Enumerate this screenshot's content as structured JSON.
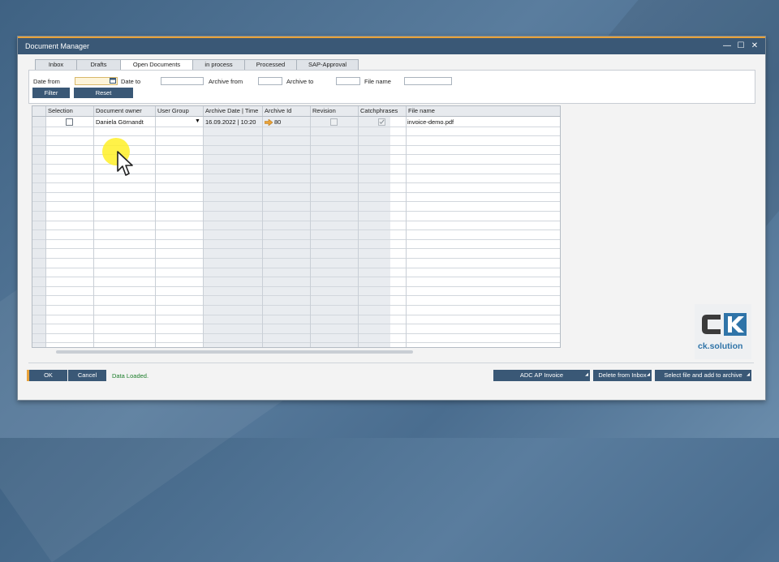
{
  "window": {
    "title": "Document Manager"
  },
  "tabs": [
    {
      "label": "Inbox"
    },
    {
      "label": "Drafts"
    },
    {
      "label": "Open Documents"
    },
    {
      "label": "in process"
    },
    {
      "label": "Processed"
    },
    {
      "label": "SAP-Approval"
    }
  ],
  "filters": {
    "date_from_label": "Date from",
    "date_to_label": "Date to",
    "archive_from_label": "Archive from",
    "archive_to_label": "Archive to",
    "file_name_label": "File name",
    "filter_button": "Filter",
    "reset_button": "Reset"
  },
  "table": {
    "columns": [
      "Selection",
      "Document owner",
      "User Group",
      "Archive Date | Time",
      "Archive Id",
      "Revision",
      "Catchphrases",
      "File name"
    ],
    "rows": [
      {
        "owner": "Daniela Görnandt",
        "archive_datetime": "16.09.2022 | 10:20",
        "archive_id": "80",
        "file_name": "invoice-demo.pdf"
      }
    ]
  },
  "footer": {
    "ok_button": "OK",
    "cancel_button": "Cancel",
    "status": "Data Loaded.",
    "adc_button": "ADC AP Invoice",
    "delete_button": "Delete from Inbox",
    "select_button": "Select file and add to archive"
  },
  "logo": {
    "text": "ck.solution"
  },
  "colors": {
    "titlebar": "#3a5876",
    "accent": "#e8a23a",
    "status": "#1d7e2b",
    "logo": "#2f74a8"
  }
}
